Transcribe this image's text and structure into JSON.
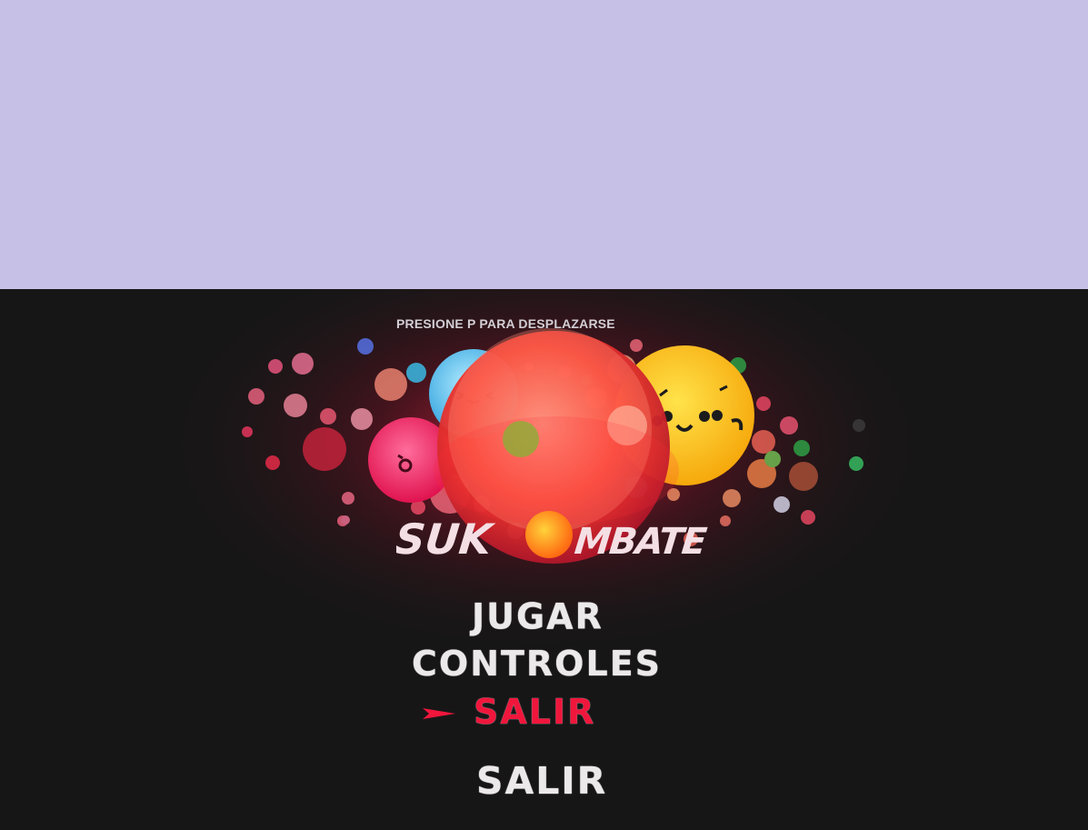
{
  "hint_text": "PRESIONE P PARA DESPLAZARSE",
  "logo": {
    "text_left": "SUK",
    "text_right": "MBATE",
    "accent_color": "#ff7a1c"
  },
  "menu": {
    "items": [
      {
        "label": "JUGAR",
        "selected": false
      },
      {
        "label": "CONTROLES",
        "selected": false
      },
      {
        "label": "SALIR",
        "selected": true
      },
      {
        "label": "SALIR",
        "selected": false
      }
    ],
    "selector_icon": "arrow-right-icon",
    "selected_color": "#f0163c",
    "text_color": "#ece9ea"
  },
  "colors": {
    "top_band": "#c6c0e6",
    "game_background": "#171617"
  }
}
